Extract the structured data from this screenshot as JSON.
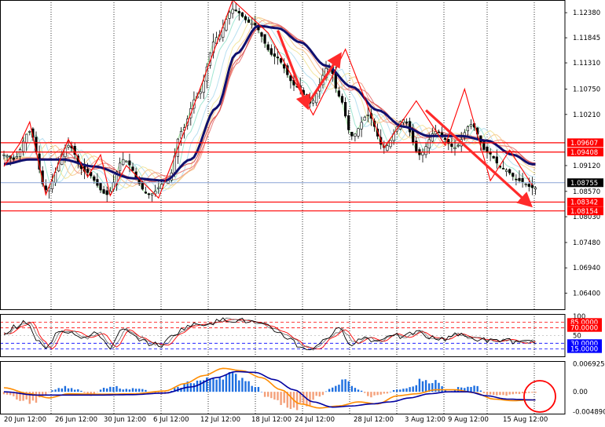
{
  "colors": {
    "background": "#ffffff",
    "frame": "#000000",
    "vgrid": "#000000",
    "candle_up": "#000000",
    "candle_down": "#000000",
    "ribbon": [
      "#a6f0a6",
      "#9fe6d2",
      "#b8e0f0",
      "#f2e6a0",
      "#f6c98f",
      "#f2a08a",
      "#e87a7a",
      "#d85050"
    ],
    "slow_ma": "#10106e",
    "zigzag": "#ff0000",
    "arrow": "#ff2a2a",
    "resistance_line": "#ff0000",
    "bid_line": "#8aa3d6",
    "rsi_main": "#000000",
    "rsi_signal": "#ff0000",
    "rsi_level_upper": "#ff0000",
    "rsi_level_lower": "#0000ff",
    "hist_pos": "#1e6fe0",
    "hist_neg": "#f4a07a",
    "macd_line": "#ff8c00",
    "signal_line": "#0000a0",
    "level_box_red": "#ff0000",
    "level_box_black": "#000000",
    "level_box_blue": "#0000ff",
    "annotation_circle": "#ff0000"
  },
  "chart_data": [
    {
      "type": "candlestick",
      "panel": "price",
      "y_ticks": [
        "1.12380",
        "1.11845",
        "1.11310",
        "1.10750",
        "1.10210",
        "1.09120",
        "1.08570",
        "1.08030",
        "1.07480",
        "1.06940",
        "1.06400"
      ],
      "x_ticks": [
        "20 Jun 12:00",
        "26 Jun 12:00",
        "30 Jun 12:00",
        "6 Jul 12:00",
        "12 Jul 12:00",
        "18 Jul 12:00",
        "24 Jul 12:00",
        "28 Jul 12:00",
        "3 Aug 12:00",
        "9 Aug 12:00",
        "15 Aug 12:00"
      ],
      "ylim": [
        1.0604,
        1.1265
      ],
      "close_anchors": [
        [
          0,
          1.0935
        ],
        [
          3,
          1.0925
        ],
        [
          8,
          1.0985
        ],
        [
          13,
          1.086
        ],
        [
          20,
          1.0955
        ],
        [
          25,
          1.09
        ],
        [
          32,
          1.085
        ],
        [
          37,
          1.0925
        ],
        [
          45,
          1.085
        ],
        [
          51,
          1.088
        ],
        [
          55,
          1.0985
        ],
        [
          60,
          1.106
        ],
        [
          66,
          1.1185
        ],
        [
          71,
          1.1245
        ],
        [
          77,
          1.1215
        ],
        [
          84,
          1.1145
        ],
        [
          91,
          1.108
        ],
        [
          95,
          1.1045
        ],
        [
          101,
          1.1125
        ],
        [
          104,
          1.106
        ],
        [
          108,
          1.0975
        ],
        [
          113,
          1.102
        ],
        [
          118,
          1.095
        ],
        [
          124,
          1.101
        ],
        [
          129,
          1.0935
        ],
        [
          134,
          1.0985
        ],
        [
          140,
          1.095
        ],
        [
          145,
          1.1
        ],
        [
          150,
          1.094
        ],
        [
          155,
          1.0905
        ],
        [
          160,
          1.088
        ],
        [
          164,
          1.0865
        ]
      ],
      "zigzag": [
        [
          0,
          1.091
        ],
        [
          5,
          1.096
        ],
        [
          8,
          1.1005
        ],
        [
          13,
          1.085
        ],
        [
          20,
          1.0968
        ],
        [
          26,
          1.0888
        ],
        [
          30,
          1.0935
        ],
        [
          33,
          1.0848
        ],
        [
          38,
          1.0912
        ],
        [
          48,
          1.0843
        ],
        [
          56,
          1.0985
        ],
        [
          71,
          1.1265
        ],
        [
          82,
          1.1195
        ],
        [
          96,
          1.102
        ],
        [
          100,
          1.1075
        ],
        [
          106,
          1.116
        ],
        [
          118,
          1.095
        ],
        [
          128,
          1.105
        ],
        [
          137,
          1.0955
        ],
        [
          143,
          1.1075
        ],
        [
          151,
          1.088
        ],
        [
          157,
          1.0945
        ],
        [
          164,
          1.087
        ]
      ],
      "slow_ma_anchors": [
        [
          0,
          1.0915
        ],
        [
          8,
          1.0925
        ],
        [
          18,
          1.0925
        ],
        [
          28,
          1.091
        ],
        [
          40,
          1.0885
        ],
        [
          50,
          1.088
        ],
        [
          58,
          1.0925
        ],
        [
          66,
          1.1035
        ],
        [
          72,
          1.115
        ],
        [
          79,
          1.121
        ],
        [
          85,
          1.1205
        ],
        [
          92,
          1.1175
        ],
        [
          100,
          1.1125
        ],
        [
          108,
          1.108
        ],
        [
          116,
          1.103
        ],
        [
          124,
          1.0995
        ],
        [
          132,
          1.0975
        ],
        [
          142,
          1.0975
        ],
        [
          150,
          1.0965
        ],
        [
          158,
          1.0935
        ],
        [
          164,
          1.0915
        ]
      ],
      "arrows": [
        {
          "from": [
            85,
            1.12
          ],
          "to": [
            94,
            1.104
          ]
        },
        {
          "from": [
            94,
            1.104
          ],
          "to": [
            104,
            1.1145
          ]
        },
        {
          "from": [
            131,
            1.103
          ],
          "to": [
            163,
            1.083
          ]
        }
      ],
      "hlines": [
        {
          "value": 1.09607,
          "label": "1.09607",
          "style": "red_box"
        },
        {
          "value": 1.09408,
          "label": "1.09408",
          "style": "red_box"
        },
        {
          "value": 1.08755,
          "label": "1.08755",
          "style": "black_box"
        },
        {
          "value": 1.08342,
          "label": "1.08342",
          "style": "red_box"
        },
        {
          "value": 1.08154,
          "label": "1.08154",
          "style": "red_box"
        }
      ]
    },
    {
      "type": "line",
      "panel": "oscillator",
      "ylim": [
        0,
        100
      ],
      "y_ticks": [
        "100",
        "50"
      ],
      "levels": [
        {
          "value": 85,
          "label": "85.0000",
          "style": "red_box"
        },
        {
          "value": 70,
          "label": "70.0000",
          "style": "red_box"
        },
        {
          "value": 30,
          "label": "30.0000",
          "style": "blue_box"
        },
        {
          "value": 15,
          "label": "15.0000",
          "style": "blue_box"
        }
      ],
      "main_anchors": [
        [
          0,
          55
        ],
        [
          4,
          75
        ],
        [
          7,
          85
        ],
        [
          10,
          40
        ],
        [
          13,
          15
        ],
        [
          17,
          65
        ],
        [
          21,
          60
        ],
        [
          25,
          45
        ],
        [
          29,
          55
        ],
        [
          33,
          20
        ],
        [
          37,
          65
        ],
        [
          41,
          45
        ],
        [
          45,
          30
        ],
        [
          49,
          25
        ],
        [
          53,
          55
        ],
        [
          57,
          75
        ],
        [
          61,
          80
        ],
        [
          65,
          85
        ],
        [
          69,
          92
        ],
        [
          73,
          90
        ],
        [
          77,
          85
        ],
        [
          81,
          75
        ],
        [
          85,
          60
        ],
        [
          89,
          40
        ],
        [
          92,
          20
        ],
        [
          96,
          15
        ],
        [
          100,
          45
        ],
        [
          104,
          65
        ],
        [
          108,
          30
        ],
        [
          112,
          45
        ],
        [
          116,
          35
        ],
        [
          120,
          55
        ],
        [
          124,
          45
        ],
        [
          128,
          60
        ],
        [
          132,
          45
        ],
        [
          136,
          40
        ],
        [
          140,
          55
        ],
        [
          144,
          45
        ],
        [
          148,
          40
        ],
        [
          152,
          35
        ],
        [
          156,
          40
        ],
        [
          160,
          30
        ],
        [
          164,
          35
        ]
      ]
    },
    {
      "type": "bar",
      "panel": "macd",
      "y_ticks": [
        "0.0069256",
        "0.00",
        "-0.0048907"
      ],
      "ylim": [
        -0.0056,
        0.0076
      ],
      "hist_anchors": [
        [
          0,
          -0.0005
        ],
        [
          5,
          -0.002
        ],
        [
          9,
          -0.0025
        ],
        [
          12,
          -0.0015
        ],
        [
          15,
          0.0005
        ],
        [
          19,
          0.0012
        ],
        [
          23,
          0.0005
        ],
        [
          27,
          -0.001
        ],
        [
          31,
          0.0008
        ],
        [
          35,
          0.0012
        ],
        [
          38,
          0.0006
        ],
        [
          42,
          0.001
        ],
        [
          46,
          -0.0002
        ],
        [
          50,
          -0.0006
        ],
        [
          54,
          0.001
        ],
        [
          58,
          0.0025
        ],
        [
          62,
          0.0028
        ],
        [
          66,
          0.0038
        ],
        [
          70,
          0.0042
        ],
        [
          74,
          0.0035
        ],
        [
          78,
          0.0015
        ],
        [
          82,
          -0.0015
        ],
        [
          86,
          -0.003
        ],
        [
          90,
          -0.0038
        ],
        [
          94,
          -0.003
        ],
        [
          98,
          -0.001
        ],
        [
          102,
          0.0012
        ],
        [
          106,
          0.0028
        ],
        [
          110,
          0.0005
        ],
        [
          114,
          -0.0012
        ],
        [
          118,
          -0.0005
        ],
        [
          122,
          0.0005
        ],
        [
          126,
          0.001
        ],
        [
          130,
          0.003
        ],
        [
          134,
          0.0025
        ],
        [
          138,
          0.0
        ],
        [
          142,
          0.0012
        ],
        [
          146,
          0.0015
        ],
        [
          150,
          -0.0008
        ],
        [
          154,
          -0.001
        ],
        [
          158,
          -0.0006
        ],
        [
          162,
          -0.0003
        ],
        [
          164,
          -0.0002
        ]
      ],
      "macd_anchors": [
        [
          0,
          0.001
        ],
        [
          8,
          -0.0005
        ],
        [
          14,
          -0.0015
        ],
        [
          20,
          -0.0005
        ],
        [
          30,
          -0.0006
        ],
        [
          40,
          -0.0005
        ],
        [
          50,
          0.0002
        ],
        [
          56,
          0.002
        ],
        [
          62,
          0.004
        ],
        [
          68,
          0.0058
        ],
        [
          74,
          0.0052
        ],
        [
          80,
          0.0035
        ],
        [
          86,
          0.0005
        ],
        [
          92,
          -0.003
        ],
        [
          98,
          -0.004
        ],
        [
          104,
          -0.0035
        ],
        [
          110,
          -0.0025
        ],
        [
          116,
          -0.003
        ],
        [
          122,
          -0.001
        ],
        [
          128,
          -0.0005
        ],
        [
          134,
          0.0005
        ],
        [
          140,
          0.0005
        ],
        [
          146,
          -0.0002
        ],
        [
          152,
          -0.0018
        ],
        [
          158,
          -0.0022
        ],
        [
          164,
          -0.002
        ]
      ],
      "signal_anchors": [
        [
          0,
          0.0
        ],
        [
          10,
          -0.0008
        ],
        [
          20,
          -0.0008
        ],
        [
          30,
          -0.0008
        ],
        [
          40,
          -0.0007
        ],
        [
          50,
          -0.0003
        ],
        [
          58,
          0.0012
        ],
        [
          66,
          0.0035
        ],
        [
          72,
          0.005
        ],
        [
          78,
          0.0048
        ],
        [
          84,
          0.003
        ],
        [
          90,
          0.0005
        ],
        [
          96,
          -0.0025
        ],
        [
          102,
          -0.0038
        ],
        [
          108,
          -0.0035
        ],
        [
          114,
          -0.003
        ],
        [
          120,
          -0.0025
        ],
        [
          126,
          -0.0015
        ],
        [
          132,
          -0.0005
        ],
        [
          138,
          0.0
        ],
        [
          144,
          0.0
        ],
        [
          150,
          -0.001
        ],
        [
          156,
          -0.0018
        ],
        [
          164,
          -0.002
        ]
      ]
    }
  ]
}
